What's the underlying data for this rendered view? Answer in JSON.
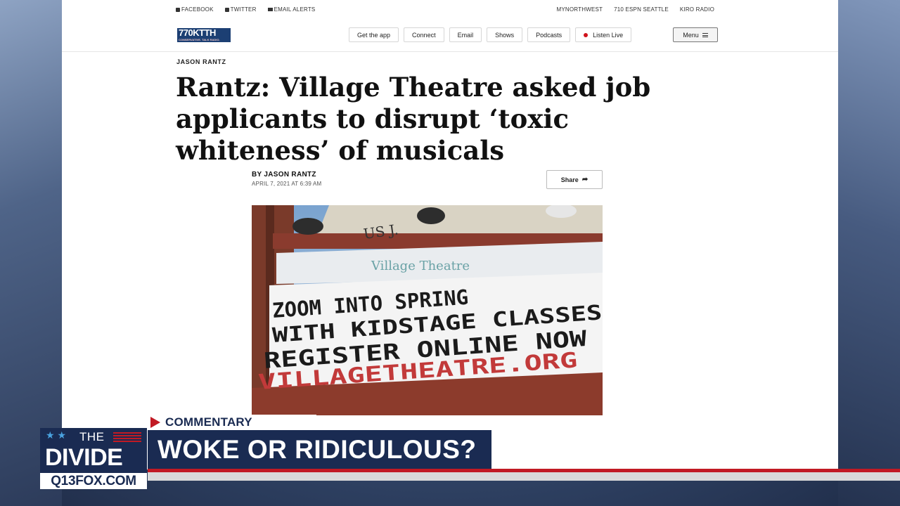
{
  "topbar": {
    "social": [
      "FACEBOOK",
      "TWITTER",
      "EMAIL ALERTS"
    ],
    "sites": [
      "MYNORTHWEST",
      "710 ESPN SEATTLE",
      "KIRO RADIO"
    ]
  },
  "logo": {
    "text_a": "770",
    "text_b": "KTTH",
    "tagline": "CONSERVATIVE. TALK RADIO."
  },
  "nav": {
    "buttons": [
      "Get the app",
      "Connect",
      "Email",
      "Shows",
      "Podcasts",
      "Listen Live"
    ],
    "menu_label": "Menu"
  },
  "article": {
    "kicker": "JASON RANTZ",
    "headline": "Rantz: Village Theatre asked job applicants to disrupt ‘toxic whiteness’ of musicals",
    "byline": "BY JASON RANTZ",
    "date": "APRIL 7, 2021 AT 6:39 AM",
    "share_label": "Share"
  },
  "photo": {
    "sign_header": "Village Theatre",
    "building_text": "US J.",
    "lines": [
      "ZOOM INTO SPRING",
      "WITH KIDSTAGE CLASSES",
      "REGISTER ONLINE NOW",
      "VILLAGETHEATRE.ORG"
    ]
  },
  "lower_third": {
    "tag": "COMMENTARY",
    "headline": "WOKE OR RIDICULOUS?",
    "show_the": "THE",
    "show_name": "DIVIDE",
    "site": "Q13FOX.COM",
    "colors": {
      "navy": "#1a2b52",
      "red": "#c11a24"
    }
  }
}
